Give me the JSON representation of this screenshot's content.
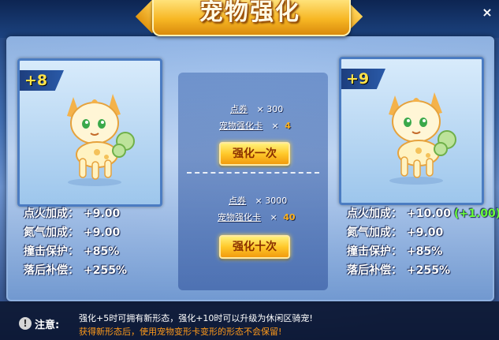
{
  "title": "宠物强化",
  "close_label": "×",
  "left_card": {
    "level": "+8",
    "stats": [
      {
        "label": "点火加成：",
        "value": "+9.00"
      },
      {
        "label": "氮气加成：",
        "value": "+9.00"
      },
      {
        "label": "撞击保护：",
        "value": "+85%"
      },
      {
        "label": "落后补偿：",
        "value": "+255%"
      }
    ]
  },
  "right_card": {
    "level": "+9",
    "stats": [
      {
        "label": "点火加成：",
        "value": "+10.00",
        "bonus": "(+1.00)"
      },
      {
        "label": "氮气加成：",
        "value": "+9.00"
      },
      {
        "label": "撞击保护：",
        "value": "+85%"
      },
      {
        "label": "落后补偿：",
        "value": "+255%"
      }
    ]
  },
  "enhance_once": {
    "coupon_label": "点券",
    "coupon_amount": "× 300",
    "card_label": "宠物强化卡",
    "card_mult": "×",
    "card_amount": "4",
    "button_label": "强化一次"
  },
  "enhance_ten": {
    "coupon_label": "点券",
    "coupon_amount": "× 3000",
    "card_label": "宠物强化卡",
    "card_mult": "×",
    "card_amount": "40",
    "button_label": "强化十次"
  },
  "notice": {
    "label": "注意:",
    "line1": "强化+5时可拥有新形态，强化+10时可以升级为休闲区骑宠!",
    "line2": "获得新形态后，使用宠物变形卡变形的形态不会保留!"
  },
  "colors": {
    "accent_orange": "#ffb21a",
    "bonus_green": "#6cff3a",
    "level_yellow": "#ffe34a"
  }
}
